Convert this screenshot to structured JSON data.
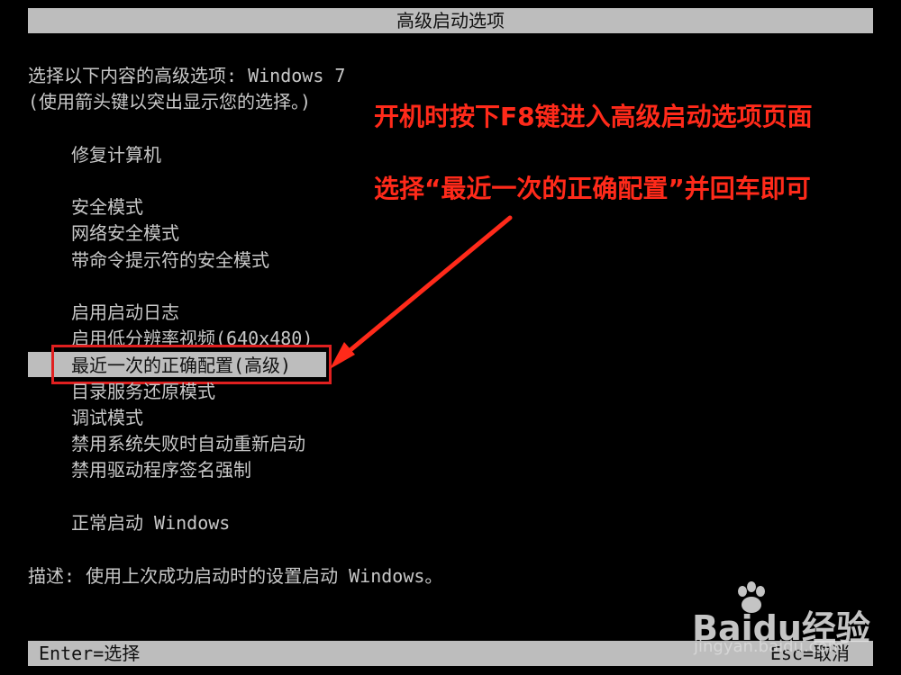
{
  "header": {
    "title": "高级启动选项"
  },
  "intro": {
    "line1": "选择以下内容的高级选项: Windows 7",
    "line2": "(使用箭头键以突出显示您的选择。)"
  },
  "menu": {
    "repair": "修复计算机",
    "safe_mode": "安全模式",
    "safe_mode_network": "网络安全模式",
    "safe_mode_cmd": "带命令提示符的安全模式",
    "boot_logging": "启用启动日志",
    "low_res_video": "启用低分辨率视频(640x480)",
    "last_known_good": "最近一次的正确配置(高级)",
    "ds_restore": "目录服务还原模式",
    "debug_mode": "调试模式",
    "disable_auto_restart": "禁用系统失败时自动重新启动",
    "disable_driver_sig": "禁用驱动程序签名强制",
    "start_normally": "正常启动 Windows",
    "selected_item": "last_known_good"
  },
  "description": "描述: 使用上次成功启动时的设置启动 Windows。",
  "footer": {
    "enter_hint": "Enter=选择",
    "esc_hint": "Esc=取消"
  },
  "annotations": {
    "note1": "开机时按下F8键进入高级启动选项页面",
    "note2": "选择“最近一次的正确配置”并回车即可",
    "color": "#ff2a1a"
  },
  "watermark": {
    "brand": "Baidu经验",
    "url": "jingyan.baidu.com"
  },
  "colors": {
    "background": "#000000",
    "bar": "#bdbdbd",
    "text": "#c8c8c8"
  }
}
